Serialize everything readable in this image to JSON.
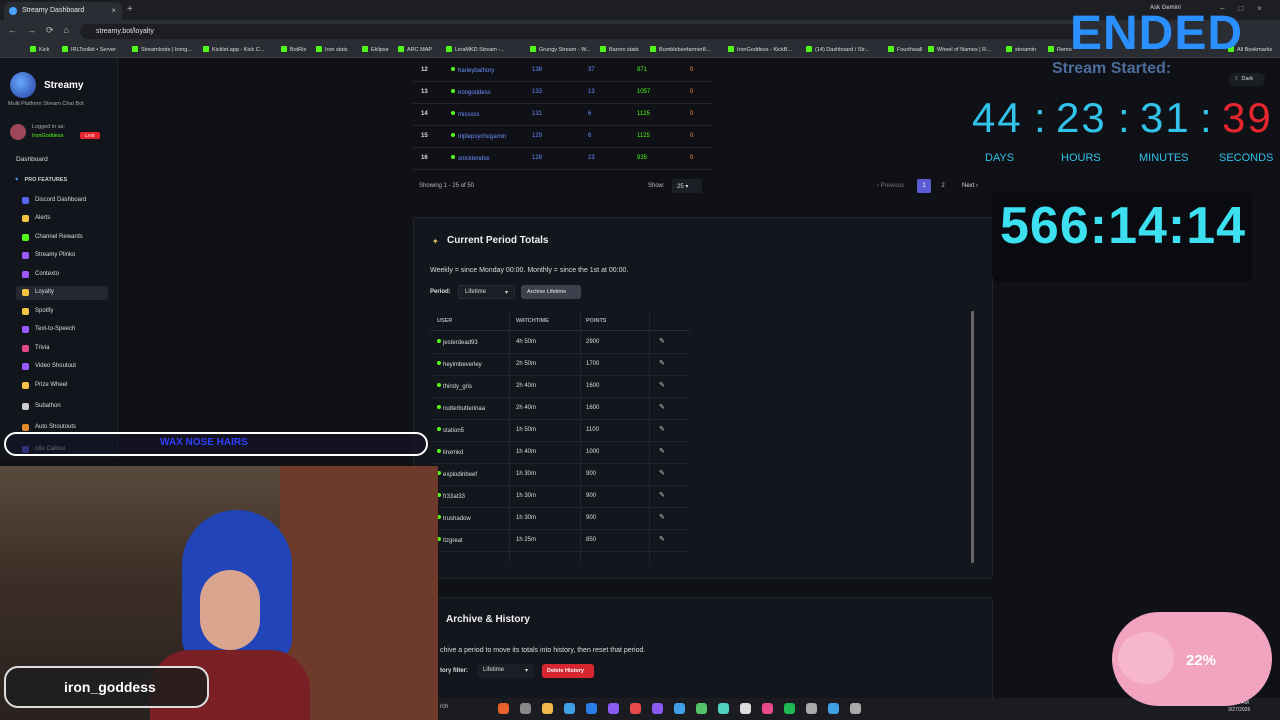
{
  "browser": {
    "tab_title": "Streamy Dashboard",
    "url": "streamy.bot/loyalty",
    "ask_gemini": "Ask Gemini",
    "bookmarks": [
      "Kick",
      "IRLToolkit • Server",
      "Streamloots | Irong...",
      "Kicklet.app - Kick C...",
      "BotRix",
      "Iron stats",
      "Eklipse",
      "ARC MAP",
      "LinaMKD Stream -...",
      "Grungy Stream - W...",
      "Barren stats",
      "Bumblebeefarmer8...",
      "IronGoddess - KickB...",
      "(14) Dashboard / Str...",
      "Fourthwall",
      "Wheel of Names | R...",
      "streamin",
      "Remo",
      "All Bookmarks"
    ]
  },
  "sidebar": {
    "brand": "Streamy",
    "tagline": "Multi Platform Stream Chat Bot",
    "logged_in_label": "Logged in as:",
    "username": "IronGoddess",
    "live": "LIVE",
    "dashboard": "Dashboard",
    "section": "PRO FEATURES",
    "items": [
      {
        "label": "Discord Dashboard",
        "color": "#5865f2"
      },
      {
        "label": "Alerts",
        "color": "#f5c542"
      },
      {
        "label": "Channel Rewards",
        "color": "#53fc18"
      },
      {
        "label": "Streamy Plinko",
        "color": "#9b59ff"
      },
      {
        "label": "Contexto",
        "color": "#9b59ff"
      },
      {
        "label": "Loyalty",
        "color": "#f5c542"
      },
      {
        "label": "Spotify",
        "color": "#f5c542"
      },
      {
        "label": "Text-to-Speech",
        "color": "#9b59ff"
      },
      {
        "label": "Trivia",
        "color": "#e04a8a"
      },
      {
        "label": "Video Shoutout",
        "color": "#9b59ff"
      },
      {
        "label": "Prize Wheel",
        "color": "#f5c542"
      },
      {
        "label": "Subathon",
        "color": "#cccccc"
      },
      {
        "label": "Auto Shoutouts",
        "color": "#e08a2a"
      },
      {
        "label": "Idle Callout",
        "color": "#5865f2"
      },
      {
        "label": "Chat",
        "color": "#cccccc"
      }
    ]
  },
  "leaderboard": {
    "rows": [
      {
        "rank": "12",
        "user": "harleybathory",
        "a": "138",
        "b": "37",
        "c": "871",
        "d": "0"
      },
      {
        "rank": "13",
        "user": "irongoddess",
        "a": "133",
        "b": "13",
        "c": "1057",
        "d": "0"
      },
      {
        "rank": "14",
        "user": "missxss",
        "a": "131",
        "b": "6",
        "c": "1125",
        "d": "0"
      },
      {
        "rank": "15",
        "user": "triplepsychogamin",
        "a": "129",
        "b": "6",
        "c": "1125",
        "d": "0"
      },
      {
        "rank": "16",
        "user": "snicktendox",
        "a": "128",
        "b": "23",
        "c": "935",
        "d": "0"
      }
    ],
    "showing": "Showing 1 - 25 of 50",
    "show_label": "Show:",
    "show_value": "25",
    "prev": "‹ Previous",
    "page1": "1",
    "page2": "2",
    "next": "Next ›"
  },
  "period_totals": {
    "title": "Current Period Totals",
    "note": "Weekly = since Monday 00:00. Monthly = since the 1st at 00:00.",
    "period_label": "Period:",
    "period_value": "Lifetime",
    "archive_button": "Archive Lifetime",
    "columns": [
      "USER",
      "WATCHTIME",
      "POINTS"
    ],
    "rows": [
      {
        "user": "jesterdead93",
        "watch": "4h 50m",
        "points": "2900"
      },
      {
        "user": "heyimbeverley",
        "watch": "2h 50m",
        "points": "1700"
      },
      {
        "user": "thirsty_gris",
        "watch": "2h 40m",
        "points": "1600"
      },
      {
        "user": "nutterbutterinaa",
        "watch": "2h 40m",
        "points": "1600"
      },
      {
        "user": "station5",
        "watch": "1h 50m",
        "points": "1100"
      },
      {
        "user": "linxmkd",
        "watch": "1h 40m",
        "points": "1000"
      },
      {
        "user": "explodinbeef",
        "watch": "1h 30m",
        "points": "900"
      },
      {
        "user": "fr33at33",
        "watch": "1h 30m",
        "points": "900"
      },
      {
        "user": "trushadow",
        "watch": "1h 30m",
        "points": "900"
      },
      {
        "user": "itzgreat",
        "watch": "1h 25m",
        "points": "850"
      }
    ]
  },
  "archive": {
    "title": "Archive & History",
    "note": "chive a period to move its totals into history, then reset that period.",
    "filter_label": "tory filter:",
    "filter_value": "Lifetime",
    "delete_button": "Delete History"
  },
  "overlay": {
    "ended": "ENDED",
    "dark": "Dark",
    "started": "Stream Started:",
    "days": "44",
    "hours": "23",
    "minutes": "31",
    "seconds": "39",
    "lbl_days": "DAYS",
    "lbl_hours": "HOURS",
    "lbl_minutes": "MINUTES",
    "lbl_seconds": "SECONDS",
    "timer": "566:14:14",
    "now_playing": "WAX NOSE HAIRS",
    "cam_name": "iron_goddess",
    "goal_pct": "22%",
    "taskbar_search": "rch",
    "clock_time": "11:31 AM",
    "clock_date": "3/27/2026"
  },
  "colors": {
    "accent": "#53fc18",
    "link": "#6b8fff",
    "timer": "#31c3ea",
    "seconds": "#e5262f",
    "danger": "#d6262f"
  }
}
